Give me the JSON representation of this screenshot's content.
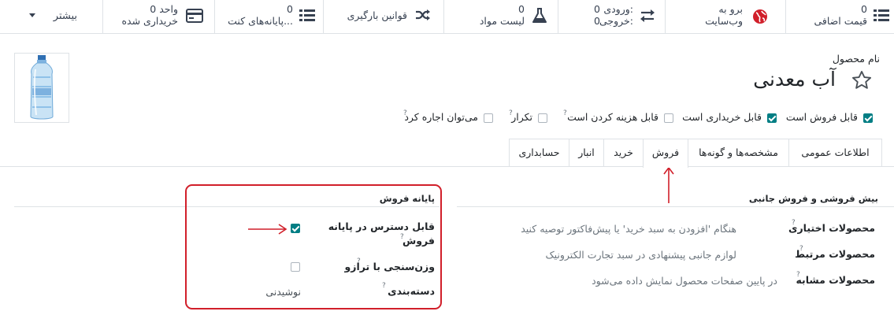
{
  "smart_buttons": {
    "more": "بیشتر",
    "purchased_count": "0 واحد",
    "purchased_label": "خریداری شده",
    "pos_count": "0",
    "pos_label": "پایانه‌های کنت...",
    "reordering_label": "قوانین بارگیری",
    "bom_count": "0",
    "bom_label": "لیست مواد",
    "in_label": "ورودی:",
    "in_value": "0",
    "out_label": "خروجی:",
    "out_value": "0",
    "website_line1": "برو به",
    "website_line2": "وب‌سایت",
    "extra_price_count": "0",
    "extra_price_label": "قیمت اضافی"
  },
  "product": {
    "name_label": "نام محصول",
    "name": "آب معدنی"
  },
  "options": [
    {
      "label": "قابل فروش است",
      "checked": true,
      "help": false
    },
    {
      "label": "قابل خریداری است",
      "checked": true,
      "help": false
    },
    {
      "label": "قابل هزینه کردن است",
      "checked": false,
      "help": true
    },
    {
      "label": "تکرار",
      "checked": false,
      "help": true
    },
    {
      "label": "می‌توان اجاره کرد",
      "checked": false,
      "help": true
    }
  ],
  "tabs": [
    "اطلاعات عمومی",
    "مشخصه‌ها و گونه‌ها",
    "فروش",
    "خرید",
    "انبار",
    "حسابداری"
  ],
  "upsell": {
    "title": "بیش فروشی و فروش جانبی",
    "optional_label": "محصولات اختیاری",
    "optional_value": "هنگام 'افزودن به سبد خرید' یا پیش‌فاکتور توصیه کنید",
    "related_label": "محصولات مرتبط",
    "related_value": "لوازم جانبی پیشنهادی در سبد تجارت الکترونیک",
    "similar_label": "محصولات مشابه",
    "similar_value": "در پایین صفحات محصول نمایش داده می‌شود"
  },
  "pos": {
    "title": "پایانه فروش",
    "available_label_1": "قابل دسترس در پایانه",
    "available_label_2": "فروش",
    "available_checked": true,
    "scale_label": "وزن‌سنجی با ترازو",
    "scale_checked": false,
    "category_label": "دسته‌بندی",
    "category_value": "نوشیدنی"
  },
  "colors": {
    "accent": "#017e84",
    "highlight": "#d11f2a",
    "favorite": "#714b67"
  }
}
